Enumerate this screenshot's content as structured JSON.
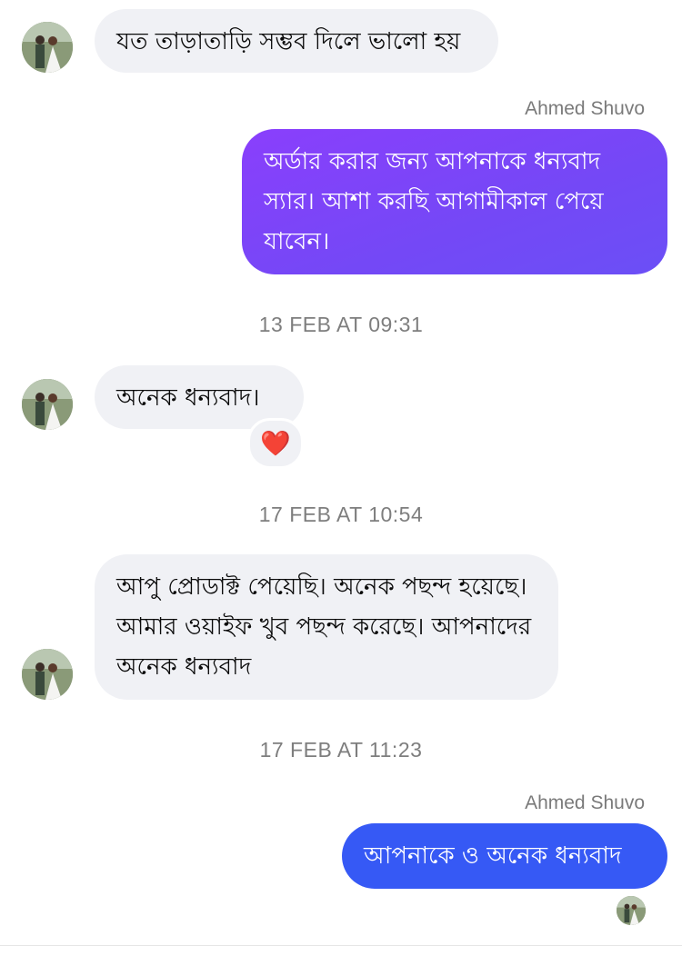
{
  "messages": [
    {
      "direction": "incoming",
      "text": "যত তাড়াতাড়ি সম্ভব দিলে ভালো হয়"
    },
    {
      "direction": "outgoing",
      "sender": "Ahmed Shuvo",
      "text": "অর্ডার করার জন্য আপনাকে ধন্যবাদ স্যার। আশা করছি আগামীকাল পেয়ে যাবেন।"
    },
    {
      "direction": "incoming",
      "text": "অনেক ধন্যবাদ।",
      "reaction": "❤️"
    },
    {
      "direction": "incoming",
      "text": "আপু প্রোডাক্ট পেয়েছি। অনেক পছন্দ হয়েছে। আমার ওয়াইফ খুব পছন্দ করেছে। আপনাদের অনেক ধন্যবাদ"
    },
    {
      "direction": "outgoing",
      "sender": "Ahmed Shuvo",
      "text": "আপনাকে ও অনেক ধন্যবাদ"
    }
  ],
  "timestamps": [
    "13 FEB AT 09:31",
    "17 FEB AT 10:54",
    "17 FEB AT 11:23"
  ],
  "icons": {
    "avatar": "contact-avatar-photo",
    "reaction": "heart-icon",
    "read_receipt": "seen-avatar-icon"
  },
  "colors": {
    "incoming_bubble": "#f0f1f5",
    "outgoing_purple": "#7448f6",
    "outgoing_blue": "#3659f5",
    "timestamp_text": "#7e7e7e"
  }
}
